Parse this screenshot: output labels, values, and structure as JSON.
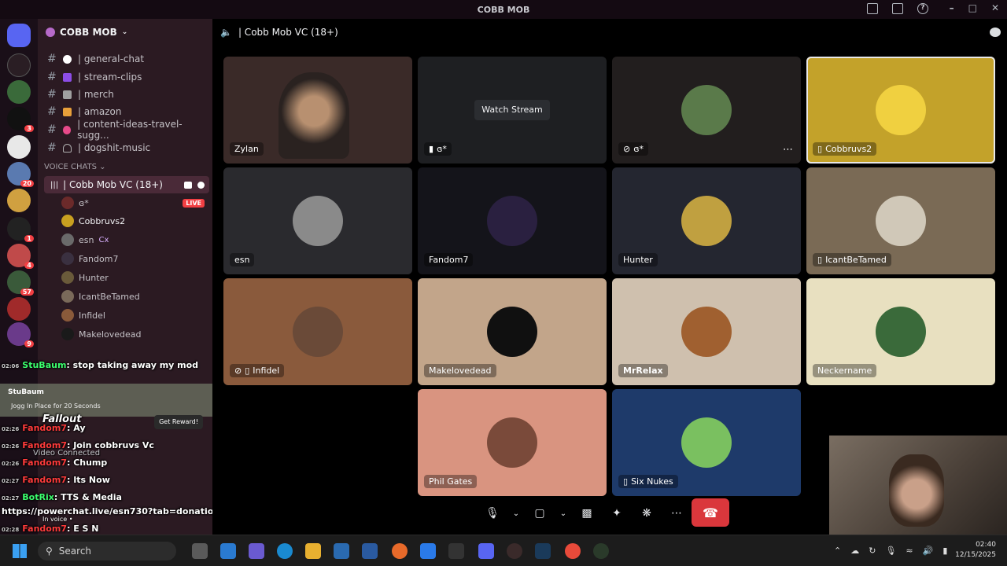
{
  "window": {
    "title": "COBB MOB"
  },
  "guild": {
    "name": "COBB MOB"
  },
  "text_channels": [
    {
      "name": "| general-chat",
      "color": "#ffffff"
    },
    {
      "name": "| stream-clips",
      "color": "#8c4de6"
    },
    {
      "name": "| merch",
      "color": "#a0a0a0"
    },
    {
      "name": "| amazon",
      "color": "#e8a03a"
    },
    {
      "name": "| content-ideas-travel-sugg...",
      "color": "#e84a8a"
    },
    {
      "name": "| dogshit-music",
      "color": "#b0b0b0"
    }
  ],
  "voice_category": "VOICE CHATS",
  "voice_channel": {
    "name": "| Cobb Mob VC (18+)"
  },
  "members": [
    {
      "name": "ɞ*",
      "live": "LIVE",
      "color": "#6b2a2a"
    },
    {
      "name": "Cobbruvs2",
      "color": "#c9a020"
    },
    {
      "name": "esn",
      "tag": "Cx",
      "color": "#6a6a6a"
    },
    {
      "name": "Fandom7",
      "color": "#3a3040"
    },
    {
      "name": "Hunter",
      "color": "#6a5a3a"
    },
    {
      "name": "IcantBeTamed",
      "color": "#7a6a5a"
    },
    {
      "name": "Infidel",
      "color": "#8a5a3a"
    },
    {
      "name": "Makelovedead",
      "color": "#1a1a1a"
    }
  ],
  "overlay_chat": [
    {
      "ts": "02:06",
      "name": "StuBaum",
      "msg": ": stop taking away my mod",
      "green": true
    },
    {
      "ts": "02:26",
      "name": "Fandom7",
      "msg": ": Ay",
      "green": false
    },
    {
      "ts": "02:26",
      "name": "Fandom7",
      "msg": ": Join cobbruvs Vc",
      "green": false
    },
    {
      "ts": "02:26",
      "name": "Fandom7",
      "msg": ": Chump",
      "green": false
    },
    {
      "ts": "02:27",
      "name": "Fandom7",
      "msg": ": Its Now",
      "green": false
    },
    {
      "ts": "02:27",
      "name": "BotRix",
      "msg": ": TTS & Media",
      "green": true
    },
    {
      "ts": "",
      "name": "",
      "msg": "https://powerchat.live/esn730?tab=donation",
      "green": false
    },
    {
      "ts": "02:28",
      "name": "Fandom7",
      "msg": ": E S N",
      "green": false
    }
  ],
  "overlay_reward": {
    "user": "StuBaum",
    "text": "Jogg In Place for 20 Seconds",
    "button": "Get Reward!",
    "fallout": "Fallout"
  },
  "voice_status": {
    "connected": "Video Connected",
    "channel": "In voice •"
  },
  "stage": {
    "header": "| Cobb Mob VC (18+)",
    "tiles": [
      {
        "name": "Zylan",
        "bg": "#3a2a28"
      },
      {
        "name": "",
        "bg": "#1e1f22",
        "watch": "Watch Stream",
        "badge": "ɞ*"
      },
      {
        "name": "ɞ*",
        "bg": "#221e1e",
        "avatar": "#5a7a4a"
      },
      {
        "name": "Cobbruvs2",
        "bg": "#c3a22a",
        "avatar": "#f0d040",
        "selected": true
      },
      {
        "name": "esn",
        "bg": "#2a2a2e",
        "avatar": "#8a8a8a"
      },
      {
        "name": "Fandom7",
        "bg": "#14141a",
        "avatar": "#2a2040"
      },
      {
        "name": "Hunter",
        "bg": "#242630",
        "avatar": "#c0a040"
      },
      {
        "name": "IcantBeTamed",
        "bg": "#7a6a55",
        "avatar": "#d0c8b8"
      },
      {
        "name": "Infidel",
        "bg": "#8a5a3c",
        "avatar": "#6a4a38"
      },
      {
        "name": "Makelovedead",
        "bg": "#c2a58a",
        "avatar": "#101010"
      },
      {
        "name": "MrRelax",
        "bg": "#cfc0ae",
        "avatar": "#a06030"
      },
      {
        "name": "Neckername",
        "bg": "#e8e0c0",
        "avatar": "#3a6a3a"
      },
      {
        "name": "Phil Gates",
        "bg": "#d99480",
        "avatar": "#7a4a3a"
      },
      {
        "name": "Six Nukes",
        "bg": "#1e3a6a",
        "avatar": "#7ac060"
      }
    ]
  },
  "taskbar": {
    "search": "Search",
    "time": "02:40",
    "date": "12/15/2025"
  }
}
